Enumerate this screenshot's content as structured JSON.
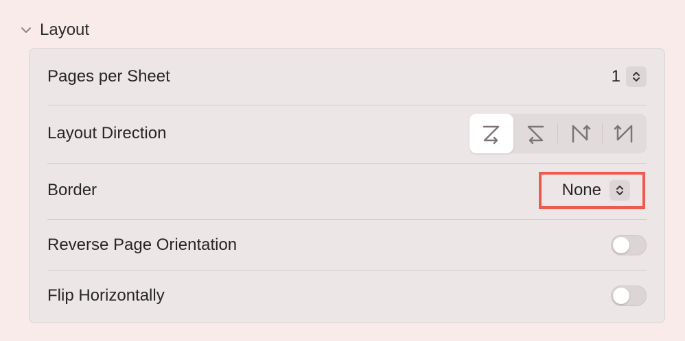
{
  "section": {
    "title": "Layout",
    "expanded": true
  },
  "rows": {
    "pages_per_sheet": {
      "label": "Pages per Sheet",
      "value": "1"
    },
    "layout_direction": {
      "label": "Layout Direction",
      "options": [
        "z-order-icon",
        "reverse-z-order-icon",
        "n-order-icon",
        "reverse-n-order-icon"
      ],
      "selected_index": 0
    },
    "border": {
      "label": "Border",
      "value": "None"
    },
    "reverse_page_orientation": {
      "label": "Reverse Page Orientation",
      "on": false
    },
    "flip_horizontally": {
      "label": "Flip Horizontally",
      "on": false
    }
  },
  "colors": {
    "background": "#f8ebea",
    "panel": "#ede6e6",
    "highlight": "#ee5a4f"
  }
}
